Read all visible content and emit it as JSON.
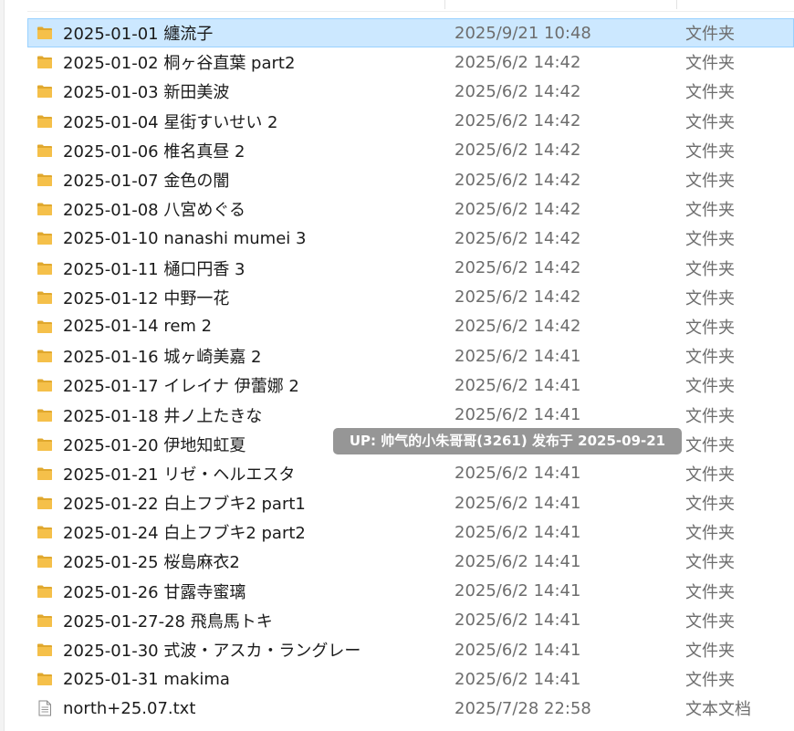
{
  "files": [
    {
      "name": "2025-01-01 纏流子",
      "date": "2025/9/21 10:48",
      "type": "文件夹",
      "icon": "folder-icon",
      "selected": true
    },
    {
      "name": "2025-01-02 桐ヶ谷直葉 part2",
      "date": "2025/6/2 14:42",
      "type": "文件夹",
      "icon": "folder-icon"
    },
    {
      "name": "2025-01-03 新田美波",
      "date": "2025/6/2 14:42",
      "type": "文件夹",
      "icon": "folder-icon"
    },
    {
      "name": "2025-01-04 星街すいせい 2",
      "date": "2025/6/2 14:42",
      "type": "文件夹",
      "icon": "folder-icon"
    },
    {
      "name": "2025-01-06 椎名真昼 2",
      "date": "2025/6/2 14:42",
      "type": "文件夹",
      "icon": "folder-icon"
    },
    {
      "name": "2025-01-07 金色の闇",
      "date": "2025/6/2 14:42",
      "type": "文件夹",
      "icon": "folder-icon"
    },
    {
      "name": "2025-01-08 八宮めぐる",
      "date": "2025/6/2 14:42",
      "type": "文件夹",
      "icon": "folder-icon"
    },
    {
      "name": "2025-01-10 nanashi mumei 3",
      "date": "2025/6/2 14:42",
      "type": "文件夹",
      "icon": "folder-icon"
    },
    {
      "name": "2025-01-11 樋口円香 3",
      "date": "2025/6/2 14:42",
      "type": "文件夹",
      "icon": "folder-icon"
    },
    {
      "name": "2025-01-12 中野一花",
      "date": "2025/6/2 14:42",
      "type": "文件夹",
      "icon": "folder-icon"
    },
    {
      "name": "2025-01-14 rem 2",
      "date": "2025/6/2 14:42",
      "type": "文件夹",
      "icon": "folder-icon"
    },
    {
      "name": "2025-01-16 城ヶ崎美嘉 2",
      "date": "2025/6/2 14:41",
      "type": "文件夹",
      "icon": "folder-icon"
    },
    {
      "name": "2025-01-17 イレイナ 伊蕾娜 2",
      "date": "2025/6/2 14:41",
      "type": "文件夹",
      "icon": "folder-icon"
    },
    {
      "name": "2025-01-18 井ノ上たきな",
      "date": "2025/6/2 14:41",
      "type": "文件夹",
      "icon": "folder-icon"
    },
    {
      "name": "2025-01-20 伊地知虹夏",
      "date": "",
      "type": "文件夹",
      "icon": "folder-icon"
    },
    {
      "name": "2025-01-21 リゼ・ヘルエスタ",
      "date": "2025/6/2 14:41",
      "type": "文件夹",
      "icon": "folder-icon"
    },
    {
      "name": "2025-01-22 白上フブキ2 part1",
      "date": "2025/6/2 14:41",
      "type": "文件夹",
      "icon": "folder-icon"
    },
    {
      "name": "2025-01-24 白上フブキ2 part2",
      "date": "2025/6/2 14:41",
      "type": "文件夹",
      "icon": "folder-icon"
    },
    {
      "name": "2025-01-25 桜島麻衣2",
      "date": "2025/6/2 14:41",
      "type": "文件夹",
      "icon": "folder-icon"
    },
    {
      "name": "2025-01-26 甘露寺蜜璃",
      "date": "2025/6/2 14:41",
      "type": "文件夹",
      "icon": "folder-icon"
    },
    {
      "name": "2025-01-27-28 飛鳥馬トキ",
      "date": "2025/6/2 14:41",
      "type": "文件夹",
      "icon": "folder-icon"
    },
    {
      "name": "2025-01-30 式波・アスカ・ラングレー",
      "date": "2025/6/2 14:41",
      "type": "文件夹",
      "icon": "folder-icon"
    },
    {
      "name": "2025-01-31 makima",
      "date": "2025/6/2 14:41",
      "type": "文件夹",
      "icon": "folder-icon"
    },
    {
      "name": "north+25.07.txt",
      "date": "2025/7/28 22:58",
      "type": "文本文档",
      "icon": "text-file-icon"
    }
  ],
  "overlay": {
    "text": "UP: 帅气的小朱哥哥(3261) 发布于 2025-09-21"
  },
  "colors": {
    "selection_bg": "#cce8ff",
    "selection_border": "#99d1ff",
    "folder": "#f5c04a",
    "folder_dark": "#e0a82e",
    "secondary_text": "#6d6d6d"
  }
}
